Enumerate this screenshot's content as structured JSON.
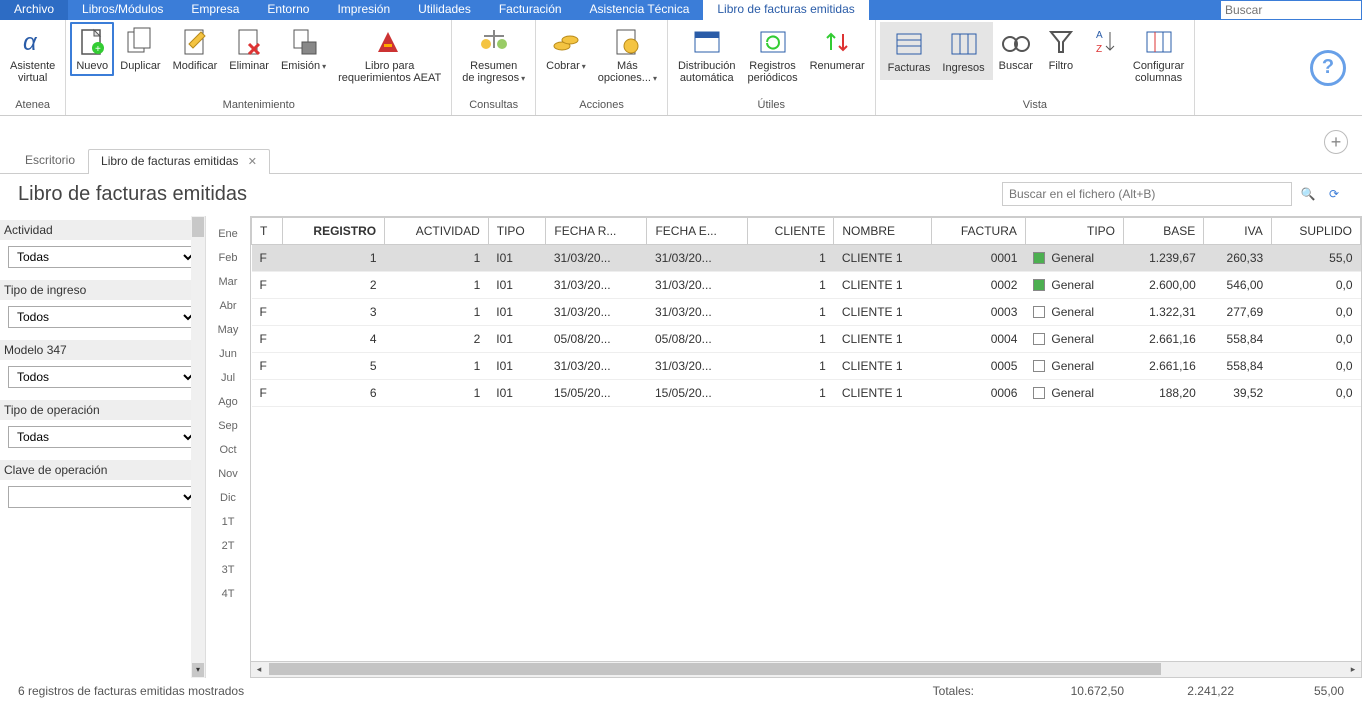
{
  "menu": {
    "items": [
      "Archivo",
      "Libros/Módulos",
      "Empresa",
      "Entorno",
      "Impresión",
      "Utilidades",
      "Facturación",
      "Asistencia Técnica"
    ],
    "active_tab": "Libro de facturas emitidas",
    "search_placeholder": "Buscar"
  },
  "ribbon": {
    "groups": [
      {
        "label": "Atenea",
        "items": [
          {
            "name": "asistente",
            "label1": "Asistente",
            "label2": "virtual"
          }
        ]
      },
      {
        "label": "Mantenimiento",
        "items": [
          {
            "name": "nuevo",
            "label1": "Nuevo",
            "selected": true
          },
          {
            "name": "duplicar",
            "label1": "Duplicar"
          },
          {
            "name": "modificar",
            "label1": "Modificar"
          },
          {
            "name": "eliminar",
            "label1": "Eliminar"
          },
          {
            "name": "emision",
            "label1": "Emisión",
            "dropdown": true
          },
          {
            "name": "libro-aeat",
            "label1": "Libro para",
            "label2": "requerimientos AEAT"
          }
        ]
      },
      {
        "label": "Consultas",
        "items": [
          {
            "name": "resumen-ingresos",
            "label1": "Resumen",
            "label2": "de ingresos",
            "dropdown": true
          }
        ]
      },
      {
        "label": "Acciones",
        "items": [
          {
            "name": "cobrar",
            "label1": "Cobrar",
            "dropdown": true
          },
          {
            "name": "mas-opciones",
            "label1": "Más",
            "label2": "opciones...",
            "dropdown": true
          }
        ]
      },
      {
        "label": "Útiles",
        "items": [
          {
            "name": "distribucion",
            "label1": "Distribución",
            "label2": "automática"
          },
          {
            "name": "registros-periodicos",
            "label1": "Registros",
            "label2": "periódicos"
          },
          {
            "name": "renumerar",
            "label1": "Renumerar"
          }
        ]
      },
      {
        "label": "Vista",
        "active": true,
        "items": [
          {
            "name": "facturas",
            "label1": "Facturas"
          },
          {
            "name": "ingresos",
            "label1": "Ingresos"
          },
          {
            "name": "buscar",
            "label1": "Buscar"
          },
          {
            "name": "filtro",
            "label1": "Filtro"
          },
          {
            "name": "sort",
            "label1": ""
          },
          {
            "name": "configurar-columnas",
            "label1": "Configurar",
            "label2": "columnas"
          }
        ]
      }
    ]
  },
  "tabs": {
    "items": [
      {
        "label": "Escritorio",
        "closable": false
      },
      {
        "label": "Libro de facturas emitidas",
        "closable": true,
        "active": true
      }
    ]
  },
  "page": {
    "title": "Libro de facturas emitidas",
    "search_placeholder": "Buscar en el fichero (Alt+B)"
  },
  "filters": {
    "actividad": {
      "label": "Actividad",
      "value": "Todas"
    },
    "tipo_ingreso": {
      "label": "Tipo de ingreso",
      "value": "Todos"
    },
    "modelo347": {
      "label": "Modelo 347",
      "value": "Todos"
    },
    "tipo_operacion": {
      "label": "Tipo de operación",
      "value": "Todas"
    },
    "clave_operacion": {
      "label": "Clave de operación",
      "value": ""
    }
  },
  "months": [
    "Ene",
    "Feb",
    "Mar",
    "Abr",
    "May",
    "Jun",
    "Jul",
    "Ago",
    "Sep",
    "Oct",
    "Nov",
    "Dic",
    "1T",
    "2T",
    "3T",
    "4T"
  ],
  "grid": {
    "columns": [
      "T",
      "REGISTRO",
      "ACTIVIDAD",
      "TIPO",
      "FECHA R...",
      "FECHA E...",
      "CLIENTE",
      "NOMBRE",
      "FACTURA",
      "TIPO",
      "BASE",
      "IVA",
      "SUPLIDO"
    ],
    "rows": [
      {
        "t": "F",
        "registro": "1",
        "actividad": "1",
        "tipo": "I01",
        "fechar": "31/03/20...",
        "fechae": "31/03/20...",
        "cliente": "1",
        "nombre": "CLIENTE 1",
        "factura": "0001",
        "tipoc": "General",
        "tipocolor": "green",
        "base": "1.239,67",
        "iva": "260,33",
        "suplido": "55,0",
        "selected": true
      },
      {
        "t": "F",
        "registro": "2",
        "actividad": "1",
        "tipo": "I01",
        "fechar": "31/03/20...",
        "fechae": "31/03/20...",
        "cliente": "1",
        "nombre": "CLIENTE 1",
        "factura": "0002",
        "tipoc": "General",
        "tipocolor": "green",
        "base": "2.600,00",
        "iva": "546,00",
        "suplido": "0,0"
      },
      {
        "t": "F",
        "registro": "3",
        "actividad": "1",
        "tipo": "I01",
        "fechar": "31/03/20...",
        "fechae": "31/03/20...",
        "cliente": "1",
        "nombre": "CLIENTE 1",
        "factura": "0003",
        "tipoc": "General",
        "tipocolor": "white",
        "base": "1.322,31",
        "iva": "277,69",
        "suplido": "0,0"
      },
      {
        "t": "F",
        "registro": "4",
        "actividad": "2",
        "tipo": "I01",
        "fechar": "05/08/20...",
        "fechae": "05/08/20...",
        "cliente": "1",
        "nombre": "CLIENTE 1",
        "factura": "0004",
        "tipoc": "General",
        "tipocolor": "white",
        "base": "2.661,16",
        "iva": "558,84",
        "suplido": "0,0"
      },
      {
        "t": "F",
        "registro": "5",
        "actividad": "1",
        "tipo": "I01",
        "fechar": "31/03/20...",
        "fechae": "31/03/20...",
        "cliente": "1",
        "nombre": "CLIENTE 1",
        "factura": "0005",
        "tipoc": "General",
        "tipocolor": "white",
        "base": "2.661,16",
        "iva": "558,84",
        "suplido": "0,0"
      },
      {
        "t": "F",
        "registro": "6",
        "actividad": "1",
        "tipo": "I01",
        "fechar": "15/05/20...",
        "fechae": "15/05/20...",
        "cliente": "1",
        "nombre": "CLIENTE 1",
        "factura": "0006",
        "tipoc": "General",
        "tipocolor": "white",
        "base": "188,20",
        "iva": "39,52",
        "suplido": "0,0"
      }
    ]
  },
  "footer": {
    "status": "6 registros de facturas emitidas mostrados",
    "totales_label": "Totales:",
    "total_base": "10.672,50",
    "total_iva": "2.241,22",
    "total_suplido": "55,00"
  }
}
